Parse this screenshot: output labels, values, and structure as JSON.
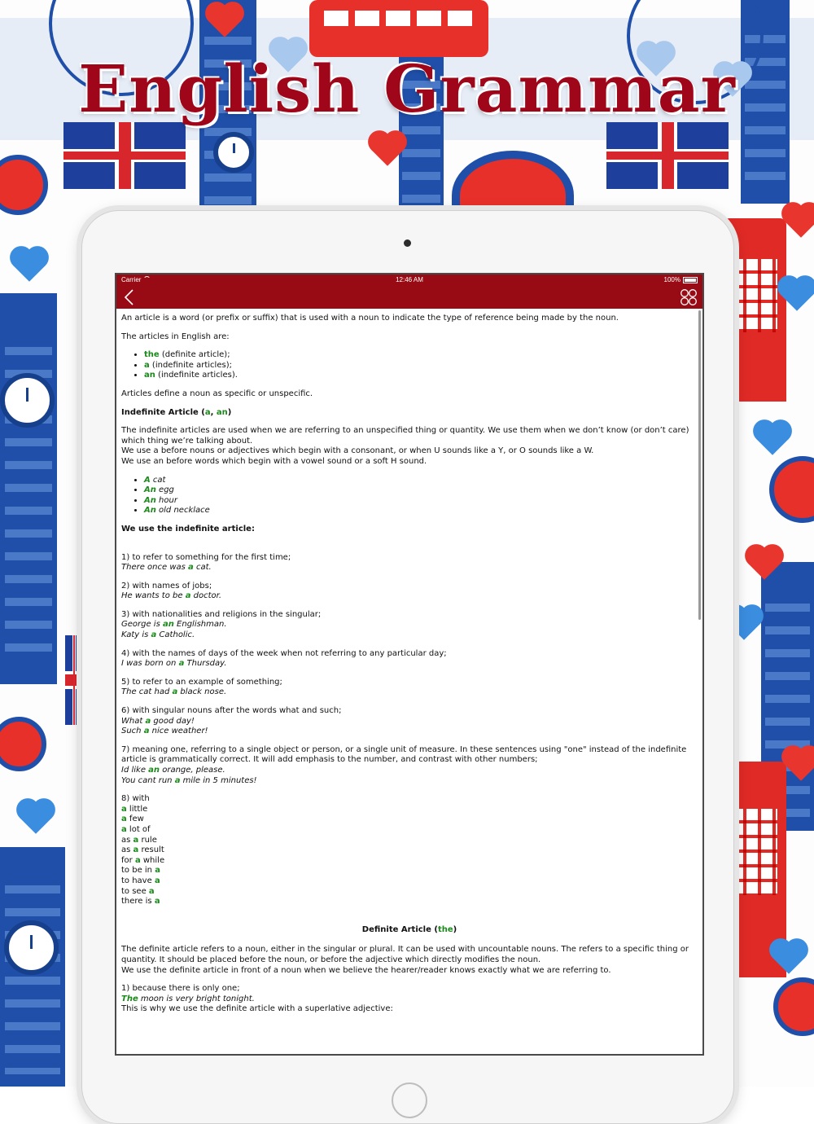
{
  "app_title": "English Grammar",
  "status_bar": {
    "carrier": "Carrier",
    "time": "12:46 AM",
    "battery": "100%"
  },
  "nav": {
    "back_icon": "chevron-left-icon",
    "menu_icon": "grid-icon"
  },
  "colors": {
    "header": "#980b14",
    "title": "#a0061a",
    "highlight": "#1a8a1a"
  },
  "article": {
    "intro": "An article is a word (or prefix or suffix) that is used with a noun to indicate the type of reference being made by the noun.",
    "articles_intro": "The articles in English are:",
    "articles_list": [
      {
        "word": "the",
        "desc": " (definite article);"
      },
      {
        "word": "a",
        "desc": " (indefinite articles);"
      },
      {
        "word": "an",
        "desc": " (indefinite articles)."
      }
    ],
    "define_line": "Articles define a noun as specific or unspecific.",
    "indef_heading": {
      "pre": "Indefinite Article (",
      "a": "a",
      "sep": ", ",
      "an": "an",
      "post": ")"
    },
    "indef_desc": [
      "The indefinite articles are used when we are referring to an unspecified thing or quantity. We use them when we don’t know (or don’t care) which thing we’re talking about.",
      "We use a before nouns or adjectives which begin with a consonant, or when U sounds like a Y, or O sounds like a W.",
      "We use an before words which begin with a vowel sound or a soft H sound."
    ],
    "indef_examples": [
      {
        "art": "A",
        "rest": " cat"
      },
      {
        "art": "An",
        "rest": " egg"
      },
      {
        "art": "An",
        "rest": " hour"
      },
      {
        "art": "An",
        "rest": " old necklace"
      }
    ],
    "use_heading": "We use the indefinite article:",
    "uses": {
      "u1": {
        "rule": "1) to refer to something for the first time;",
        "ex1": [
          "There once was ",
          "a",
          " cat."
        ]
      },
      "u2": {
        "rule": "2) with names of jobs;",
        "ex1": [
          "He wants to be ",
          "a",
          " doctor."
        ]
      },
      "u3": {
        "rule": "3) with nationalities and religions in the singular;",
        "ex1": [
          "George is ",
          "an",
          " Englishman."
        ],
        "ex2": [
          "Katy is ",
          "a",
          " Catholic."
        ]
      },
      "u4": {
        "rule": "4) with the names of days of the week when not referring to any particular day;",
        "ex1": [
          "I was born on ",
          "a",
          " Thursday."
        ]
      },
      "u5": {
        "rule": "5) to refer to an example of something;",
        "ex1": [
          "The cat had ",
          "a",
          " black nose."
        ]
      },
      "u6": {
        "rule": "6) with singular nouns after the words what and such;",
        "ex1": [
          "What ",
          "a",
          " good day!"
        ],
        "ex2": [
          "Such ",
          "a",
          " nice weather!"
        ]
      },
      "u7": {
        "rule": "7) meaning one, referring to a single object or person, or a single unit of measure. In these sentences using \"one\" instead of the indefinite article is grammatically correct. It will add emphasis to the number, and contrast with other numbers;",
        "ex1": [
          "Id like ",
          "an",
          " orange, please."
        ],
        "ex2": [
          "You cant run ",
          "a",
          " mile in 5 minutes!"
        ]
      }
    },
    "u8_head": "8) with",
    "u8_list": [
      [
        "",
        "a",
        " little"
      ],
      [
        "",
        "a",
        " few"
      ],
      [
        "",
        "a",
        " lot of"
      ],
      [
        "as ",
        "a",
        " rule"
      ],
      [
        "as ",
        "a",
        " result"
      ],
      [
        "for ",
        "a",
        " while"
      ],
      [
        "to be in ",
        "a",
        ""
      ],
      [
        "to have ",
        "a",
        ""
      ],
      [
        "to see ",
        "a",
        ""
      ],
      [
        "there is ",
        "a",
        ""
      ]
    ],
    "def_heading": {
      "pre": "Definite Article (",
      "the": "the",
      "post": ")"
    },
    "def_desc": [
      "The definite article refers to a noun, either in the singular or plural. It can be used with uncountable nouns. The refers to a specific thing or quantity. It should be placed before the noun, or before the adjective which directly modifies the noun.",
      "We use the definite article in front of a noun when we believe the hearer/reader knows exactly what we are referring to."
    ],
    "def_u1": {
      "rule": "1) because there is only one;",
      "ex_art": "The",
      "ex_rest": " moon is very bright tonight.",
      "tail": "This is why we use the definite article with a superlative adjective:"
    }
  }
}
